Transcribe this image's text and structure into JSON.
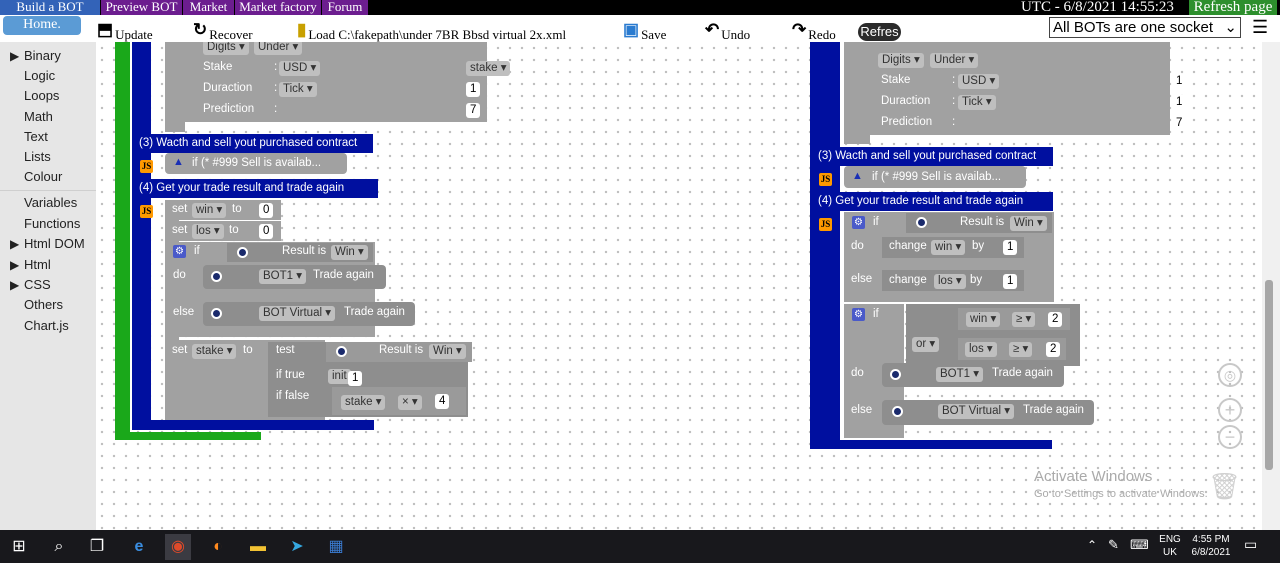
{
  "nav": {
    "tabs": [
      "Build a BOT",
      "Preview BOT",
      "Market",
      "Market factory",
      "Forum"
    ],
    "clock": "UTC - 6/8/2021 14:55:23",
    "refresh_page": "Refresh page",
    "home": "Home."
  },
  "toolbar": {
    "update": "Update",
    "recover": "Recover",
    "load": "Load C:\\fakepath\\under 7BR Bbsd virtual 2x.xml",
    "save": "Save",
    "undo": "Undo",
    "redo": "Redo",
    "refres": "Refres",
    "socket_select": "All BOTs are one socket"
  },
  "sidebar": {
    "items": [
      "Binary",
      "Logic",
      "Loops",
      "Math",
      "Text",
      "Lists",
      "Colour",
      "Variables",
      "Functions",
      "Html DOM",
      "Html",
      "CSS",
      "Others",
      "Chart.js"
    ]
  },
  "left_bot": {
    "digits": "Digits",
    "under": "Under",
    "stake_label": "Stake",
    "stake_currency": "USD",
    "stake_var": "stake",
    "duration_label": "Duraction",
    "duration_unit": "Tick",
    "duration_val": "1",
    "prediction_label": "Prediction",
    "prediction_val": "7",
    "sec3": "(3) Wacth and sell yout purchased contract",
    "sec3_cond": "if (* #999  Sell is availab...",
    "sec4": "(4) Get your trade result and trade again",
    "set": "set",
    "win": "win",
    "los": "los",
    "to": "to",
    "zero": "0",
    "if": "if",
    "result_is": "Result is",
    "win_opt": "Win",
    "do": "do",
    "bot1": "BOT1",
    "trade_again": "Trade again",
    "else": "else",
    "bot_virtual": "BOT Virtual",
    "stake_word": "stake",
    "test": "test",
    "if_true": "if true",
    "init": "init",
    "init_val": "1",
    "if_false": "if false",
    "times": "×",
    "four": "4"
  },
  "right_bot": {
    "digits": "Digits",
    "under": "Under",
    "stake_label": "Stake",
    "stake_currency": "USD",
    "stake_val": "1",
    "duration_label": "Duraction",
    "duration_unit": "Tick",
    "duration_val": "1",
    "prediction_label": "Prediction",
    "prediction_val": "7",
    "sec3": "(3) Wacth and sell yout purchased contract",
    "sec3_cond": "if (* #999  Sell is availab...",
    "sec4": "(4) Get your trade result and trade again",
    "if": "if",
    "result_is": "Result is",
    "win_opt": "Win",
    "do": "do",
    "change": "change",
    "win": "win",
    "by": "by",
    "one": "1",
    "else": "else",
    "los": "los",
    "or": "or",
    "gte": "≥",
    "two": "2",
    "bot1": "BOT1",
    "trade_again": "Trade again",
    "bot_virtual": "BOT Virtual"
  },
  "watermark": {
    "line1": "Activate Windows",
    "line2": "Go to Settings to activate Windows."
  },
  "taskbar": {
    "lang": "ENG",
    "region": "UK",
    "time": "4:55 PM",
    "date": "6/8/2021"
  }
}
